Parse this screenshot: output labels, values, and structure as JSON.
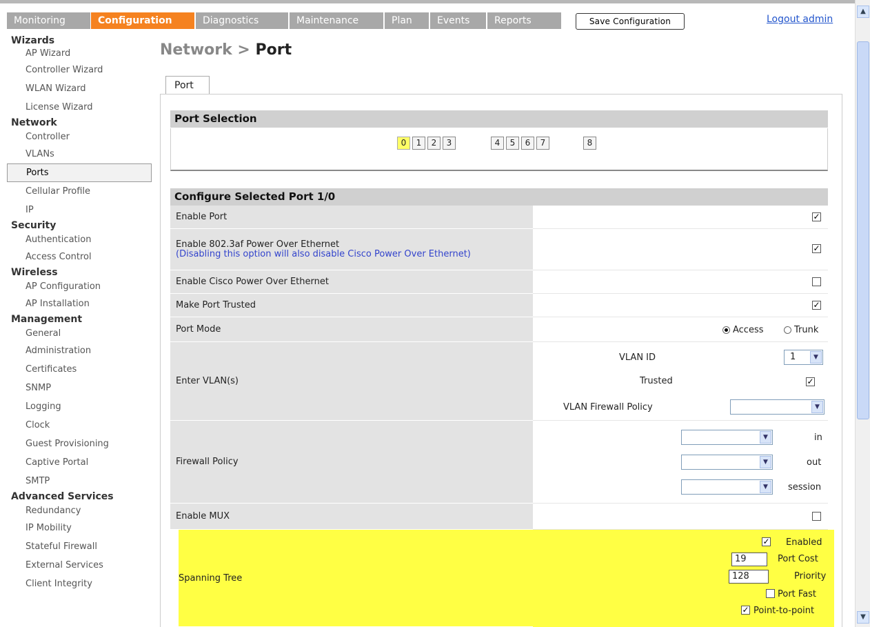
{
  "nav": {
    "tabs": [
      "Monitoring",
      "Configuration",
      "Diagnostics",
      "Maintenance",
      "Plan",
      "Events",
      "Reports"
    ],
    "active_tab": "Configuration",
    "save_label": "Save Configuration",
    "logout_label": "Logout admin"
  },
  "sidebar": {
    "sections": [
      {
        "label": "Wizards",
        "items": [
          "AP Wizard",
          "Controller Wizard",
          "WLAN Wizard",
          "License Wizard"
        ]
      },
      {
        "label": "Network",
        "items": [
          "Controller",
          "VLANs",
          "Ports",
          "Cellular Profile",
          "IP"
        ]
      },
      {
        "label": "Security",
        "items": [
          "Authentication",
          "Access Control"
        ]
      },
      {
        "label": "Wireless",
        "items": [
          "AP Configuration",
          "AP Installation"
        ]
      },
      {
        "label": "Management",
        "items": [
          "General",
          "Administration",
          "Certificates",
          "SNMP",
          "Logging",
          "Clock",
          "Guest Provisioning",
          "Captive Portal",
          "SMTP"
        ]
      },
      {
        "label": "Advanced Services",
        "items": [
          "Redundancy",
          "IP Mobility",
          "Stateful Firewall",
          "External Services",
          "Client Integrity"
        ]
      }
    ],
    "active_item": "Ports"
  },
  "page": {
    "title_prefix": "Network >",
    "title_main": "Port",
    "tab_label": "Port"
  },
  "port_selection": {
    "header": "Port Selection",
    "ports": [
      "0",
      "1",
      "2",
      "3",
      "4",
      "5",
      "6",
      "7",
      "8"
    ],
    "selected": "0"
  },
  "configure": {
    "header": "Configure Selected Port 1/0",
    "enable_port": {
      "label": "Enable Port",
      "checked": true
    },
    "poe": {
      "label": "Enable 802.3af Power Over Ethernet",
      "note": "(Disabling this option will also disable Cisco Power Over Ethernet)",
      "checked": true
    },
    "cisco_poe": {
      "label": "Enable Cisco Power Over Ethernet",
      "checked": false
    },
    "trusted": {
      "label": "Make Port Trusted",
      "checked": true
    },
    "port_mode": {
      "label": "Port Mode",
      "options": [
        "Access",
        "Trunk"
      ],
      "selected": "Access"
    },
    "vlans": {
      "label": "Enter VLAN(s)",
      "vlan_id_label": "VLAN ID",
      "vlan_id_value": "1",
      "trusted_label": "Trusted",
      "trusted_checked": true,
      "firewall_label": "VLAN Firewall Policy",
      "firewall_value": ""
    },
    "firewall": {
      "label": "Firewall Policy",
      "rows": [
        {
          "dir": "in",
          "value": ""
        },
        {
          "dir": "out",
          "value": ""
        },
        {
          "dir": "session",
          "value": ""
        }
      ]
    },
    "mux": {
      "label": "Enable MUX",
      "checked": false
    },
    "spanning_tree": {
      "label": "Spanning Tree",
      "enabled_label": "Enabled",
      "enabled": true,
      "port_cost_label": "Port Cost",
      "port_cost": "19",
      "priority_label": "Priority",
      "priority": "128",
      "port_fast_label": "Port Fast",
      "port_fast": false,
      "p2p_label": "Point-to-point",
      "p2p": true
    }
  },
  "colors": {
    "accent": "#f58220",
    "highlight": "#ffff44",
    "tab_gray": "#a8a8a8"
  }
}
